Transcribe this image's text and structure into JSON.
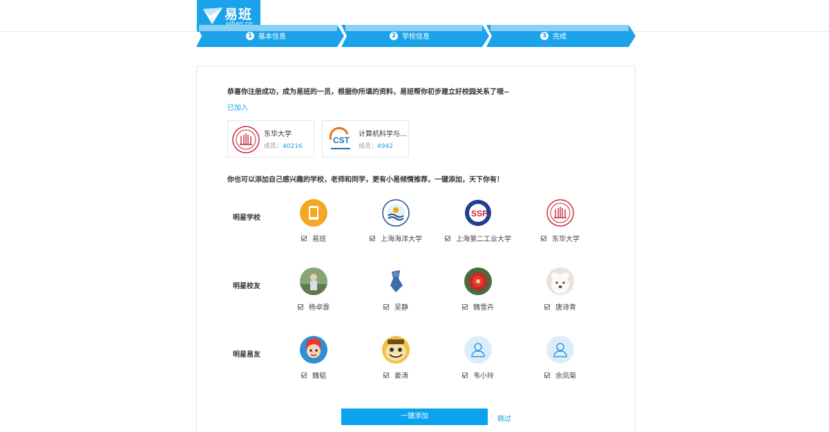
{
  "brand": {
    "name": "易班",
    "domain": "yiban.cn",
    "accent": "#1aa3ea"
  },
  "steps": [
    {
      "num": "1",
      "label": "基本信息"
    },
    {
      "num": "2",
      "label": "学校信息"
    },
    {
      "num": "3",
      "label": "完成"
    }
  ],
  "intro_text": "恭喜你注册成功，成为易班的一员，根据你所填的资料，易班帮你初步建立好校园关系了哦~",
  "joined": {
    "title": "已加入",
    "groups": [
      {
        "name": "东华大学",
        "members_label": "成员：",
        "members": "40216",
        "icon": "donghua-seal-icon"
      },
      {
        "name": "计算机科学与技...",
        "members_label": "成员：",
        "members": "4942",
        "icon": "cst-logo-icon"
      }
    ]
  },
  "recommend_prompt": "你也可以添加自己感兴趣的学校，老师和同学，更有小易倾情推荐，一键添加，天下你有！",
  "rows": [
    {
      "label": "明星学校",
      "items": [
        {
          "name": "易班",
          "checked": true,
          "icon": "yiban-app-icon"
        },
        {
          "name": "上海海洋大学",
          "checked": true,
          "icon": "ocean-university-seal-icon"
        },
        {
          "name": "上海第二工业大学",
          "checked": true,
          "icon": "sspu-seal-icon"
        },
        {
          "name": "东华大学",
          "checked": true,
          "icon": "donghua-seal-icon"
        }
      ]
    },
    {
      "label": "明星校友",
      "items": [
        {
          "name": "杨卓霏",
          "checked": true,
          "icon": "photo-avatar-icon"
        },
        {
          "name": "吴静",
          "checked": true,
          "icon": "figure-avatar-icon"
        },
        {
          "name": "魏雪卉",
          "checked": true,
          "icon": "flower-avatar-icon"
        },
        {
          "name": "唐诗青",
          "checked": true,
          "icon": "bear-avatar-icon"
        }
      ]
    },
    {
      "label": "明星易友",
      "items": [
        {
          "name": "魏韬",
          "checked": true,
          "icon": "cartoon-avatar-icon"
        },
        {
          "name": "姜涛",
          "checked": true,
          "icon": "cartoon-face-avatar-icon"
        },
        {
          "name": "韦小玲",
          "checked": true,
          "icon": "default-user-icon"
        },
        {
          "name": "余凤菊",
          "checked": true,
          "icon": "default-user-icon"
        }
      ]
    }
  ],
  "actions": {
    "add_all": "一键添加",
    "skip": "跳过"
  }
}
